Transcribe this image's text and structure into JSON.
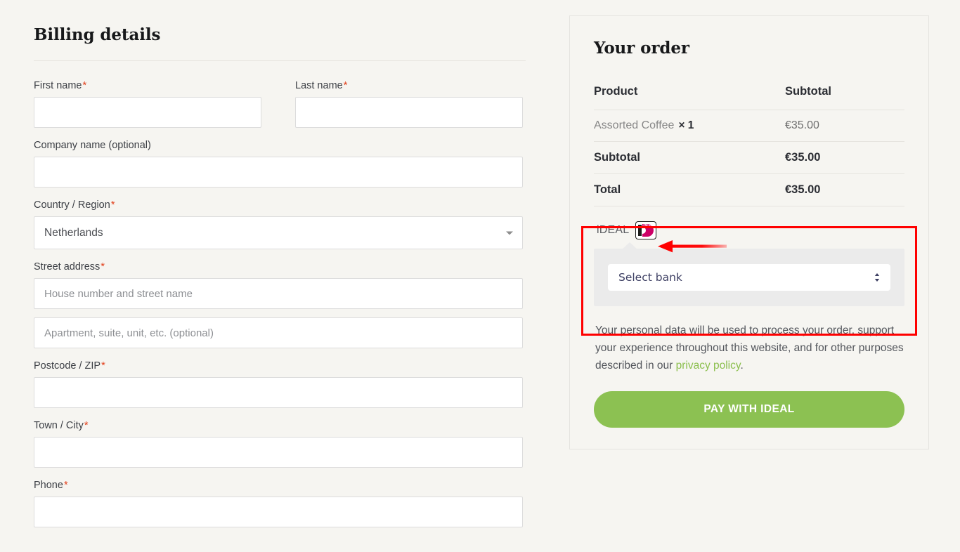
{
  "billing": {
    "title": "Billing details",
    "fields": [
      {
        "label": "First name",
        "required": true,
        "value": "",
        "placeholder": ""
      },
      {
        "label": "Last name",
        "required": true,
        "value": "",
        "placeholder": ""
      },
      {
        "label": "Company name (optional)",
        "required": false,
        "value": "",
        "placeholder": ""
      },
      {
        "label": "Country / Region",
        "required": true,
        "value": "Netherlands",
        "placeholder": ""
      },
      {
        "label": "Street address",
        "required": true,
        "value": "",
        "placeholder": "House number and street name"
      },
      {
        "label": "",
        "required": false,
        "value": "",
        "placeholder": "Apartment, suite, unit, etc. (optional)"
      },
      {
        "label": "Postcode / ZIP",
        "required": true,
        "value": "",
        "placeholder": ""
      },
      {
        "label": "Town / City",
        "required": true,
        "value": "",
        "placeholder": ""
      },
      {
        "label": "Phone",
        "required": true,
        "value": "",
        "placeholder": ""
      }
    ],
    "required_marker": "*"
  },
  "order": {
    "title": "Your order",
    "table": {
      "headers": [
        "Product",
        "Subtotal"
      ],
      "item": {
        "name": "Assorted Coffee",
        "quantity": "× 1",
        "amount": "€35.00"
      },
      "subtotal": {
        "label": "Subtotal",
        "amount": "€35.00"
      },
      "total": {
        "label": "Total",
        "amount": "€35.00"
      }
    },
    "payment": {
      "method_label": "iDEAL",
      "logo_name": "ideal-logo",
      "logo_text": "DEAL",
      "bank_select_value": "Select bank"
    },
    "privacy": {
      "text_before": "Your personal data will be used to process your order, support your experience throughout this website, and for other purposes described in our ",
      "link_text": "privacy policy",
      "text_after": "."
    },
    "pay_button_label": "PAY WITH IDEAL"
  },
  "colors": {
    "page_background": "#f6f5f1",
    "accent_green": "#8cc152",
    "link_green": "#8bbf4d",
    "required_red": "#e2401c",
    "annotation_red": "#ff0000",
    "ideal_magenta": "#cc0066",
    "payment_box_gray": "#ebebeb"
  }
}
